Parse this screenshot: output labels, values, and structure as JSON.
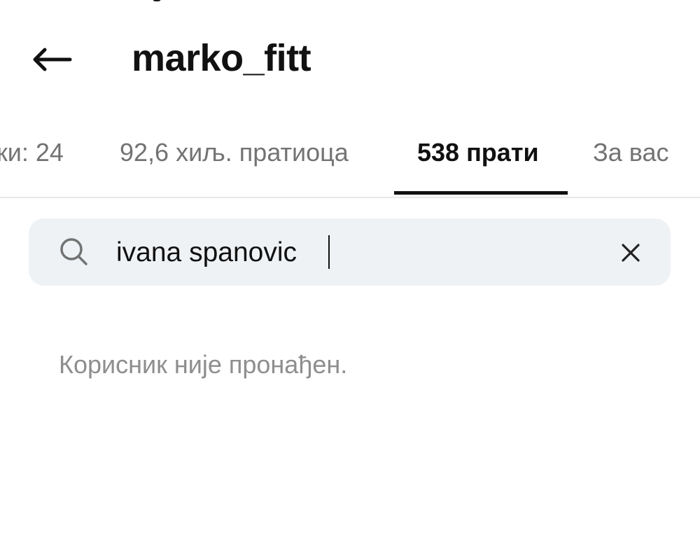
{
  "header": {
    "title": "marko_fitt",
    "back_icon": "arrow-left-icon"
  },
  "tabs": [
    {
      "label": "ки: 24"
    },
    {
      "label": "92,6 хиљ. пратиоца"
    },
    {
      "label": "538 прати",
      "active": true
    },
    {
      "label": "За вас"
    }
  ],
  "search": {
    "value": "ivana spanovic",
    "icon": "search-icon",
    "clear_icon": "close-icon"
  },
  "results": {
    "empty_message": "Корисник није пронађен."
  },
  "colors": {
    "text_primary": "#111111",
    "text_secondary": "#737373",
    "empty_text": "#8e8e8e",
    "search_background": "#eff2f5",
    "active_tab_indicator": "#111111"
  }
}
